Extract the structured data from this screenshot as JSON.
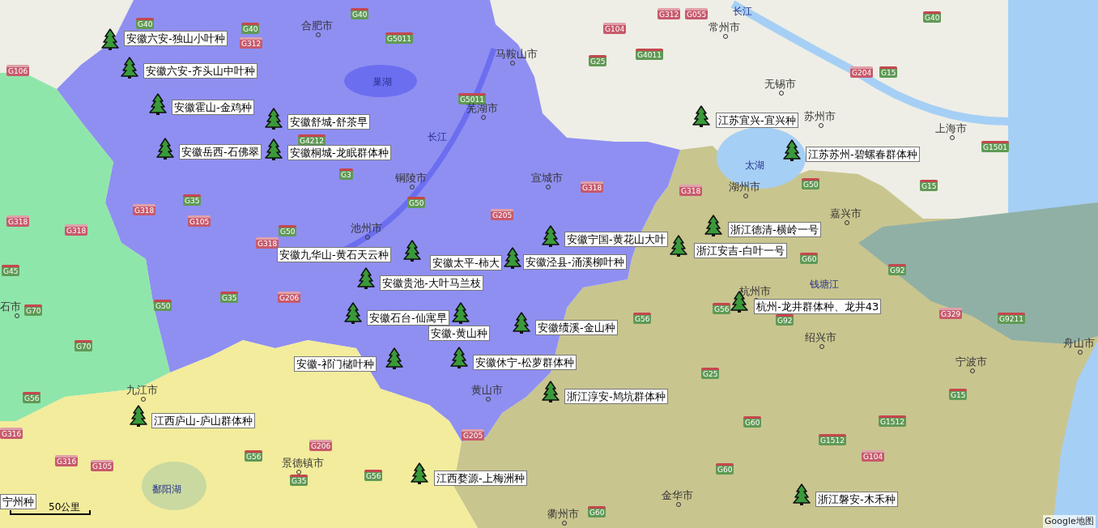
{
  "map": {
    "water_labels": [
      {
        "text": "长江"
      },
      {
        "text": "巢湖"
      },
      {
        "text": "长江"
      },
      {
        "text": "太湖"
      },
      {
        "text": "钱塘江"
      },
      {
        "text": "鄱阳湖"
      }
    ],
    "cities": [
      {
        "name": "合肥市"
      },
      {
        "name": "马鞍山市"
      },
      {
        "name": "芜湖市"
      },
      {
        "name": "铜陵市"
      },
      {
        "name": "宣城市"
      },
      {
        "name": "池州市"
      },
      {
        "name": "常州市"
      },
      {
        "name": "无锡市"
      },
      {
        "name": "苏州市"
      },
      {
        "name": "上海市"
      },
      {
        "name": "湖州市"
      },
      {
        "name": "嘉兴市"
      },
      {
        "name": "杭州市"
      },
      {
        "name": "绍兴市"
      },
      {
        "name": "宁波市"
      },
      {
        "name": "舟山市"
      },
      {
        "name": "石市"
      },
      {
        "name": "九江市"
      },
      {
        "name": "黄山市"
      },
      {
        "name": "景德镇市"
      },
      {
        "name": "金华市"
      },
      {
        "name": "衢州市"
      }
    ],
    "road_shields": [
      {
        "text": "G40",
        "kind": "expressway"
      },
      {
        "text": "G40",
        "kind": "expressway"
      },
      {
        "text": "G40",
        "kind": "expressway"
      },
      {
        "text": "G312",
        "kind": "national"
      },
      {
        "text": "G106",
        "kind": "national"
      },
      {
        "text": "G5011",
        "kind": "expressway"
      },
      {
        "text": "G5011",
        "kind": "expressway"
      },
      {
        "text": "G4212",
        "kind": "expressway"
      },
      {
        "text": "G3",
        "kind": "expressway"
      },
      {
        "text": "G50",
        "kind": "expressway"
      },
      {
        "text": "G35",
        "kind": "expressway"
      },
      {
        "text": "G318",
        "kind": "national"
      },
      {
        "text": "G105",
        "kind": "national"
      },
      {
        "text": "G318",
        "kind": "national"
      },
      {
        "text": "G318",
        "kind": "national"
      },
      {
        "text": "G50",
        "kind": "expressway"
      },
      {
        "text": "G318",
        "kind": "national"
      },
      {
        "text": "G205",
        "kind": "national"
      },
      {
        "text": "G45",
        "kind": "expressway"
      },
      {
        "text": "G70",
        "kind": "expressway"
      },
      {
        "text": "G50",
        "kind": "expressway"
      },
      {
        "text": "G35",
        "kind": "expressway"
      },
      {
        "text": "G206",
        "kind": "national"
      },
      {
        "text": "G70",
        "kind": "expressway"
      },
      {
        "text": "G56",
        "kind": "expressway"
      },
      {
        "text": "G316",
        "kind": "national"
      },
      {
        "text": "G316",
        "kind": "national"
      },
      {
        "text": "G105",
        "kind": "national"
      },
      {
        "text": "G206",
        "kind": "national"
      },
      {
        "text": "G56",
        "kind": "expressway"
      },
      {
        "text": "G35",
        "kind": "expressway"
      },
      {
        "text": "G56",
        "kind": "expressway"
      },
      {
        "text": "G205",
        "kind": "national"
      },
      {
        "text": "G312",
        "kind": "national"
      },
      {
        "text": "G055",
        "kind": "national"
      },
      {
        "text": "G104",
        "kind": "national"
      },
      {
        "text": "G25",
        "kind": "expressway"
      },
      {
        "text": "G4011",
        "kind": "expressway"
      },
      {
        "text": "G40",
        "kind": "expressway"
      },
      {
        "text": "G204",
        "kind": "national"
      },
      {
        "text": "G15",
        "kind": "expressway"
      },
      {
        "text": "G1501",
        "kind": "expressway"
      },
      {
        "text": "G318",
        "kind": "national"
      },
      {
        "text": "G318",
        "kind": "national"
      },
      {
        "text": "G50",
        "kind": "expressway"
      },
      {
        "text": "G15",
        "kind": "expressway"
      },
      {
        "text": "G60",
        "kind": "expressway"
      },
      {
        "text": "G92",
        "kind": "expressway"
      },
      {
        "text": "G56",
        "kind": "expressway"
      },
      {
        "text": "G56",
        "kind": "expressway"
      },
      {
        "text": "G92",
        "kind": "expressway"
      },
      {
        "text": "G329",
        "kind": "national"
      },
      {
        "text": "G9211",
        "kind": "expressway"
      },
      {
        "text": "G25",
        "kind": "expressway"
      },
      {
        "text": "G15",
        "kind": "expressway"
      },
      {
        "text": "G60",
        "kind": "expressway"
      },
      {
        "text": "G1512",
        "kind": "expressway"
      },
      {
        "text": "G1512",
        "kind": "expressway"
      },
      {
        "text": "G104",
        "kind": "national"
      },
      {
        "text": "G60",
        "kind": "expressway"
      },
      {
        "text": "G60",
        "kind": "expressway"
      }
    ],
    "markers": [
      {
        "kind": "tree",
        "label": "安徽六安-独山小叶种"
      },
      {
        "kind": "tree",
        "label": "安徽六安-齐头山中叶种"
      },
      {
        "kind": "tree",
        "label": "安徽霍山-金鸡种"
      },
      {
        "kind": "tree",
        "label": "安徽舒城-舒茶早"
      },
      {
        "kind": "tree",
        "label": "安徽岳西-石佛翠"
      },
      {
        "kind": "tree",
        "label": "安徽桐城-龙眠群体种"
      },
      {
        "kind": "tree",
        "label": "安徽九华山-黄石天云种"
      },
      {
        "kind": "tree",
        "label": "安徽太平-柿大"
      },
      {
        "kind": "tree",
        "label": "安徽宁国-黄花山大叶"
      },
      {
        "kind": "label",
        "label": "安徽泾县-涌溪柳叶种"
      },
      {
        "kind": "tree",
        "label": "安徽贵池-大叶马兰枝"
      },
      {
        "kind": "tree",
        "label": "安徽石台-仙寓早"
      },
      {
        "kind": "tree",
        "label": "安徽-黄山种"
      },
      {
        "kind": "tree",
        "label": "安徽绩溪-金山种"
      },
      {
        "kind": "tree",
        "label": "安徽-祁门槠叶种"
      },
      {
        "kind": "tree",
        "label": "安徽休宁-松萝群体种"
      },
      {
        "kind": "tree",
        "label": "浙江淳安-鸠坑群体种"
      },
      {
        "kind": "tree",
        "label": "江西庐山-庐山群体种"
      },
      {
        "kind": "tree",
        "label": "江西婺源-上梅洲种"
      },
      {
        "kind": "tree",
        "label": "江苏宜兴-宜兴种"
      },
      {
        "kind": "tree",
        "label": "江苏苏州-碧螺春群体种"
      },
      {
        "kind": "tree",
        "label": "浙江德清-横岭一号"
      },
      {
        "kind": "tree",
        "label": "浙江安吉-白叶一号"
      },
      {
        "kind": "tree",
        "label": "杭州-龙井群体种、龙井43"
      },
      {
        "kind": "label",
        "label": "宁州种"
      },
      {
        "kind": "tree",
        "label": "浙江磐安-木禾种"
      }
    ],
    "scale": "50公里",
    "attribution": "Google地图"
  }
}
